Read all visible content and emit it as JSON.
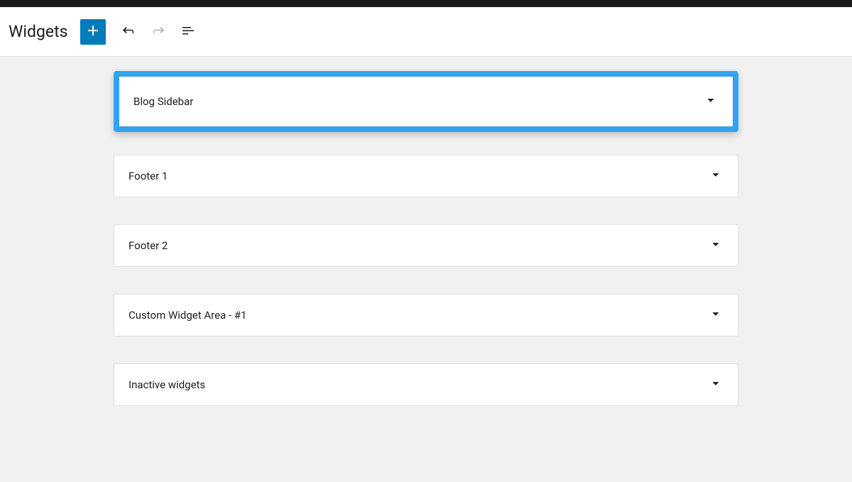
{
  "header": {
    "title": "Widgets"
  },
  "widget_areas": [
    {
      "label": "Blog Sidebar",
      "highlighted": true
    },
    {
      "label": "Footer 1",
      "highlighted": false
    },
    {
      "label": "Footer 2",
      "highlighted": false
    },
    {
      "label": "Custom Widget Area - #1",
      "highlighted": false
    },
    {
      "label": "Inactive widgets",
      "highlighted": false
    }
  ]
}
